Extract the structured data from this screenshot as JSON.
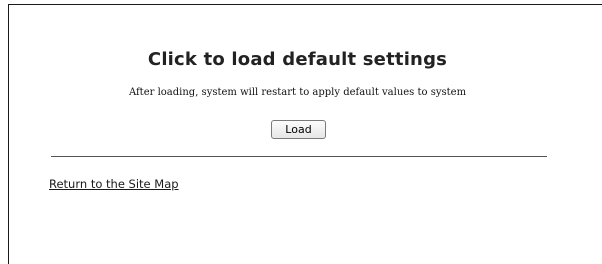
{
  "main": {
    "title": "Click to load default settings",
    "description": "After loading, system will restart to apply default values to system",
    "load_button_label": "Load"
  },
  "footer": {
    "site_map_link": "Return to the Site Map"
  }
}
